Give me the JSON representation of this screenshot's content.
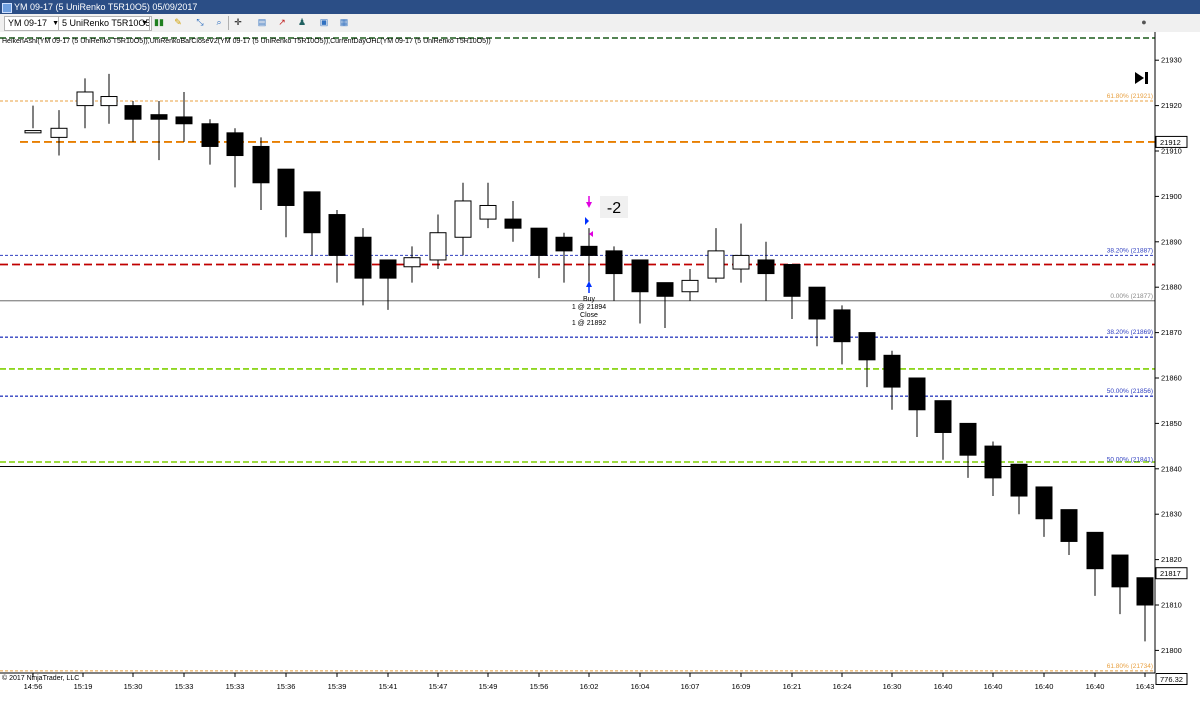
{
  "window": {
    "title": "YM 09-17 (5 UniRenko T5R10O5) 05/09/2017"
  },
  "toolbar": {
    "instrument": "YM 09-17",
    "period": "5 UniRenko T5R10O5",
    "icons": [
      "bar-type-icon",
      "drawing-pencil-icon",
      "drawing-tools-icon",
      "zoom-icon",
      "crosshair-icon",
      "data-box-icon",
      "indicators-icon",
      "strategies-icon",
      "properties-icon",
      "snapshot-icon",
      "close-chart-icon"
    ]
  },
  "chart": {
    "indicator_label": "HeikenAshi(YM 09-17 (5 UniRenko T5R10O5)),UniRenkoBarCloseV2(YM 09-17 (5 UniRenko T5R10O5)),CurrentDayOHL(YM 09-17 (5 UniRenko T5R10O5))",
    "copyright": "© 2017 NinjaTrader, LLC",
    "price_axis_ticks": [
      21930,
      21920,
      21910,
      21900,
      21890,
      21880,
      21870,
      21860,
      21850,
      21840,
      21830,
      21820,
      21810,
      21800
    ],
    "price_markers": [
      {
        "label": "21912",
        "color": "#000000",
        "fill": "#ffffff"
      },
      {
        "label": "21817",
        "color": "#000000",
        "fill": "#ffffff"
      },
      {
        "label": "776.32",
        "color": "#000000",
        "fill": "#ffffff"
      }
    ],
    "time_labels": [
      "14:56",
      "15:19",
      "15:30",
      "15:33",
      "15:33",
      "15:36",
      "15:39",
      "15:41",
      "15:47",
      "15:49",
      "15:56",
      "16:02",
      "16:04",
      "16:07",
      "16:09",
      "16:21",
      "16:24",
      "16:30",
      "16:40",
      "16:40",
      "16:40",
      "16:40",
      "16:43"
    ],
    "fib_labels": [
      {
        "text": "61.80% (21921)",
        "color": "#e8a040"
      },
      {
        "text": "38.20% (21887)",
        "color": "#3040c0"
      },
      {
        "text": "0.00% (21877)",
        "color": "#888888"
      },
      {
        "text": "38.20% (21869)",
        "color": "#3040c0"
      },
      {
        "text": "50.00% (21856)",
        "color": "#3040c0"
      },
      {
        "text": "50.00% (21841)",
        "color": "#3040c0"
      },
      {
        "text": "61.80% (21734)",
        "color": "#e8a040"
      }
    ],
    "trade": {
      "entry_label": "Buy",
      "entry_price": "1 @ 21894",
      "exit_label": "Close",
      "exit_price": "1 @ 21892",
      "pnl_ticks": "-2"
    },
    "colors": {
      "bear_candle": "#000000",
      "bull_candle": "#ffffff",
      "fib_orange": "#e8a040",
      "fib_blue": "#3040c0",
      "open_line_orange": "#e87f00",
      "prev_line_red": "#c00000",
      "lime_line": "#7fd000",
      "dark_green_line": "#1a5c1a",
      "buy_arrow": "#0030ff",
      "exit_arrow": "#e000e0"
    }
  }
}
